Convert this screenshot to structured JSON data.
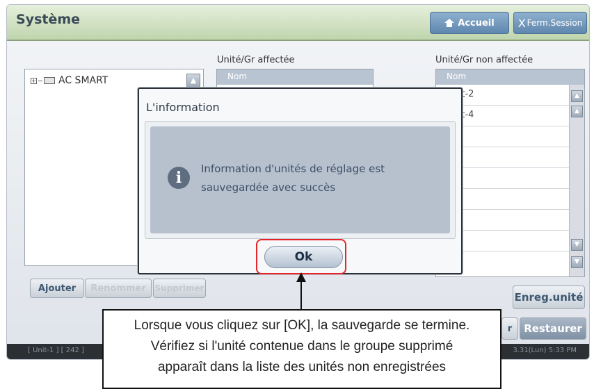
{
  "window": {
    "title": "Système",
    "home_label": "Accueil",
    "logout_label": "Ferm.Session"
  },
  "columns": {
    "assigned_title": "Unité/Gr affectée",
    "unassigned_title": "Unité/Gr non affectée",
    "name_header": "Nom"
  },
  "tree": {
    "root_label": "AC SMART"
  },
  "unassigned_units": [
    "Unit-2",
    "Unit-4"
  ],
  "buttons": {
    "add": "Ajouter",
    "rename": "Renommer",
    "delete": "Supprimer",
    "save_unit": "Enreg.unité",
    "restore": "Restaurer",
    "partial": "r"
  },
  "status": {
    "left": "[ Unit-1 ] [ 242 ]",
    "right": "3.31(Lun) 5:33 PM"
  },
  "dialog": {
    "title": "L'information",
    "message_line1": "Information d'unités de réglage est",
    "message_line2": "sauvegardée avec succès",
    "ok_label": "Ok",
    "icon": "info-icon"
  },
  "callout": {
    "line1": "Lorsque vous cliquez sur [OK], la sauvegarde se termine.",
    "line2": "Vérifiez si l'unité contenue dans le groupe supprimé",
    "line3": "apparaît dans la liste des unités non enregistrées"
  },
  "colors": {
    "highlight": "#e6252a",
    "header_green": "#bfd5ad",
    "dialog_fill": "#b7c1ce"
  }
}
